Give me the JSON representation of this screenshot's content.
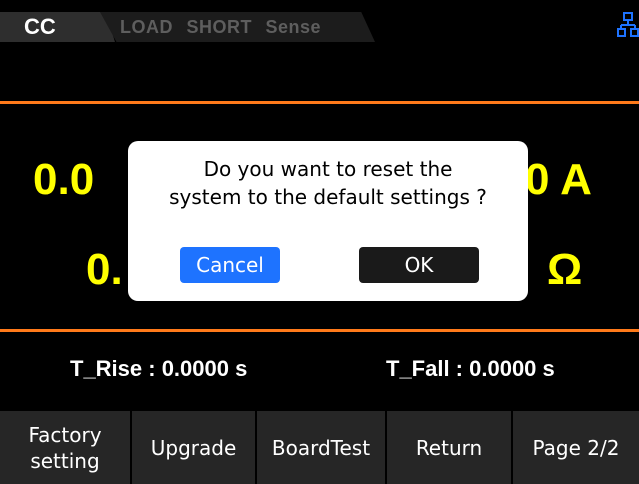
{
  "status_bar": {
    "mode_active": "CC",
    "modes_inactive": "LOAD  SHORT  Sense",
    "network_icon": "network-icon"
  },
  "display": {
    "current_left": "0.0",
    "current_right": "0 A",
    "resistance_left": "0.",
    "resistance_right": "Ω"
  },
  "dialog": {
    "message_line1": "Do you want to reset the",
    "message_line2": "system to the default settings ?",
    "cancel_label": "Cancel",
    "ok_label": "OK"
  },
  "params": {
    "rise": "T_Rise : 0.0000 s",
    "fall": "T_Fall : 0.0000 s"
  },
  "menu": [
    {
      "label": "Factory\nsetting"
    },
    {
      "label": "Upgrade"
    },
    {
      "label": "BoardTest"
    },
    {
      "label": "Return"
    },
    {
      "label": "Page 2/2"
    }
  ],
  "colors": {
    "accent_line": "#ff7a1a",
    "measurement": "#ffff00",
    "cancel_button": "#1e73ff",
    "network_icon": "#1e73ff"
  }
}
